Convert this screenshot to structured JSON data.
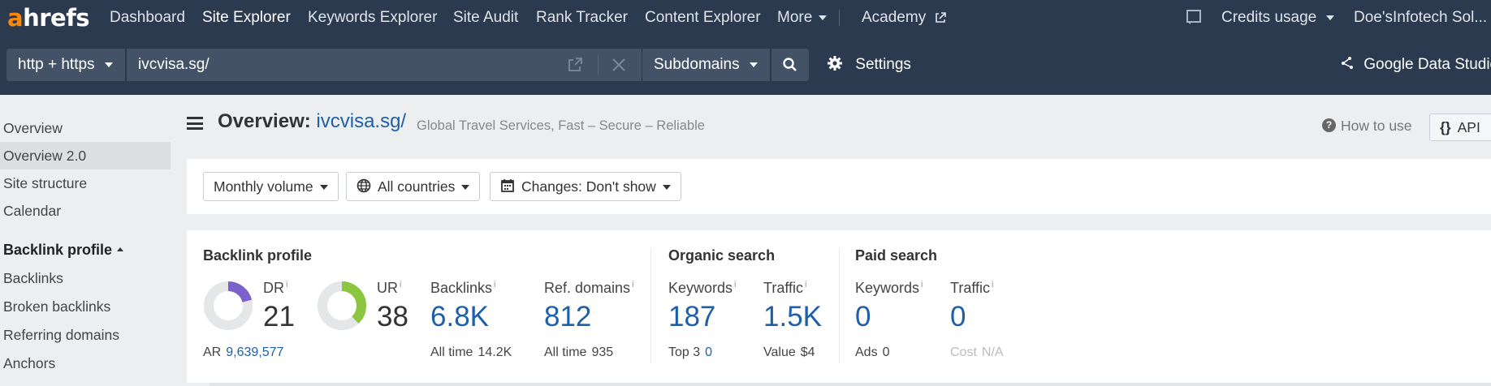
{
  "brand": {
    "logo_a": "a",
    "logo_rest": "hrefs"
  },
  "nav": {
    "items": [
      "Dashboard",
      "Site Explorer",
      "Keywords Explorer",
      "Site Audit",
      "Rank Tracker",
      "Content Explorer",
      "More"
    ],
    "academy": "Academy",
    "credits": "Credits usage",
    "account": "Doe'sInfotech Sol..."
  },
  "search": {
    "protocol": "http + https",
    "url": "ivcvisa.sg/",
    "mode": "Subdomains",
    "settings": "Settings",
    "gds": "Google Data Studio"
  },
  "sidebar": {
    "items": [
      "Overview",
      "Overview 2.0",
      "Site structure",
      "Calendar"
    ],
    "section": "Backlink profile",
    "section_items": [
      "Backlinks",
      "Broken backlinks",
      "Referring domains",
      "Anchors"
    ]
  },
  "header": {
    "title_prefix": "Overview:",
    "title_domain": "ivcvisa.sg/",
    "subtitle": "Global Travel Services, Fast – Secure – Reliable",
    "how_to_use": "How to use",
    "api": "API"
  },
  "filters": {
    "volume": "Monthly volume",
    "countries": "All countries",
    "changes": "Changes: Don't show"
  },
  "metrics": {
    "backlink_profile": {
      "title": "Backlink profile",
      "dr_label": "DR",
      "dr_value": "21",
      "dr_fraction": 0.21,
      "ar_label": "AR",
      "ar_value": "9,639,577",
      "ur_label": "UR",
      "ur_value": "38",
      "ur_fraction": 0.38,
      "backlinks_label": "Backlinks",
      "backlinks_value": "6.8K",
      "backlinks_sub_label": "All time",
      "backlinks_sub_value": "14.2K",
      "refdomains_label": "Ref. domains",
      "refdomains_value": "812",
      "refdomains_sub_label": "All time",
      "refdomains_sub_value": "935"
    },
    "organic": {
      "title": "Organic search",
      "keywords_label": "Keywords",
      "keywords_value": "187",
      "top3_label": "Top 3",
      "top3_value": "0",
      "traffic_label": "Traffic",
      "traffic_value": "1.5K",
      "value_label": "Value",
      "value_value": "$4"
    },
    "paid": {
      "title": "Paid search",
      "keywords_label": "Keywords",
      "keywords_value": "0",
      "ads_label": "Ads",
      "ads_value": "0",
      "traffic_label": "Traffic",
      "traffic_value": "0",
      "cost_label": "Cost",
      "cost_value": "N/A"
    }
  },
  "colors": {
    "nav_bg": "#2c3a4f",
    "accent_orange": "#ff8800",
    "link_blue": "#1d5fa8",
    "dr_purple": "#7b61c9",
    "ur_green": "#8cc63f"
  }
}
